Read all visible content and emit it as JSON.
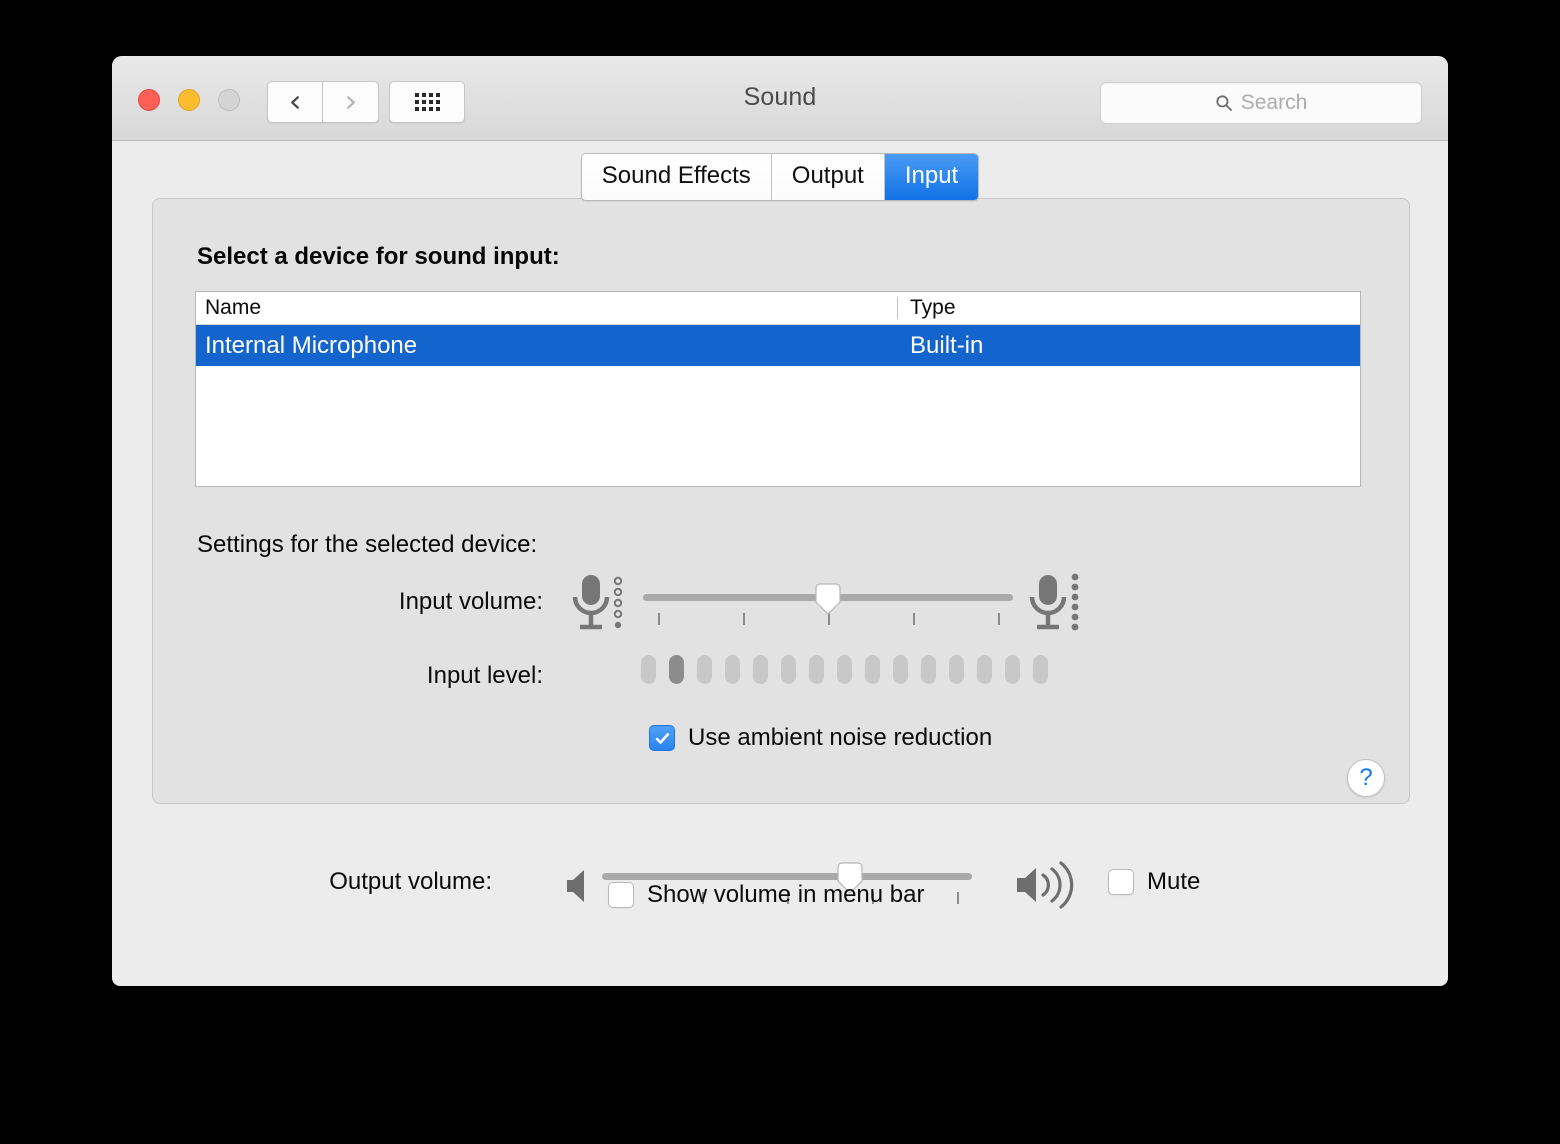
{
  "window": {
    "title": "Sound",
    "traffic_lights": [
      {
        "name": "close",
        "color": "#ff5f57"
      },
      {
        "name": "minimize",
        "color": "#febc2e"
      },
      {
        "name": "zoom",
        "color": "#d4d4d4"
      }
    ],
    "nav": {
      "back_label": "Back",
      "forward_label": "Forward",
      "show_all_label": "Show All"
    },
    "search": {
      "placeholder": "Search",
      "value": "",
      "icon": "search-icon"
    }
  },
  "tabs": [
    {
      "label": "Sound Effects",
      "selected": false
    },
    {
      "label": "Output",
      "selected": false
    },
    {
      "label": "Input",
      "selected": true
    }
  ],
  "panel": {
    "select_device_label": "Select a device for sound input:",
    "settings_label": "Settings for the selected device:",
    "table": {
      "columns": [
        "Name",
        "Type"
      ],
      "rows": [
        {
          "name": "Internal Microphone",
          "type": "Built-in",
          "selected": true
        }
      ]
    },
    "input_volume": {
      "label": "Input volume:",
      "value_percent": 50,
      "tick_count": 5,
      "low_icon": "microphone-low-icon",
      "high_icon": "microphone-high-icon"
    },
    "input_level": {
      "label": "Input level:",
      "segment_count": 15,
      "active_segments": [
        1
      ]
    },
    "noise_reduction": {
      "label": "Use ambient noise reduction",
      "checked": true
    },
    "help_button": {
      "label": "?"
    }
  },
  "output": {
    "volume_label": "Output volume:",
    "value_percent": 67,
    "tick_count": 5,
    "low_icon": "speaker-low-icon",
    "high_icon": "speaker-high-icon",
    "mute": {
      "label": "Mute",
      "checked": false
    },
    "show_volume_in_menu_bar": {
      "label": "Show volume in menu bar",
      "checked": false
    }
  },
  "colors": {
    "accent_blue": "#1272e6",
    "selection_blue": "#1464cd",
    "checkbox_blue": "#2a85f0",
    "help_blue": "#1179f2",
    "window_bg": "#ececec",
    "panel_bg": "#e2e2e2"
  }
}
